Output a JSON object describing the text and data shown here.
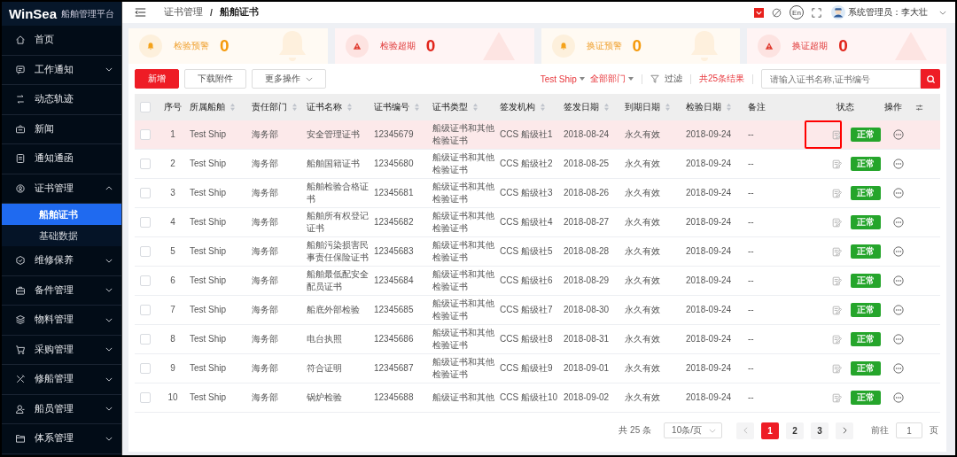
{
  "brand": {
    "logo": "WinSea",
    "subtitle": "船舶管理平台"
  },
  "sidebar": {
    "items": [
      {
        "label": "首页",
        "kind": "link"
      },
      {
        "label": "工作通知",
        "kind": "group",
        "expanded": false
      },
      {
        "label": "动态轨迹",
        "kind": "link"
      },
      {
        "label": "新闻",
        "kind": "link"
      },
      {
        "label": "通知通函",
        "kind": "link"
      },
      {
        "label": "证书管理",
        "kind": "group",
        "expanded": true,
        "children": [
          {
            "label": "船舶证书",
            "selected": true
          },
          {
            "label": "基础数据",
            "selected": false
          }
        ]
      },
      {
        "label": "维修保养",
        "kind": "group",
        "expanded": false
      },
      {
        "label": "备件管理",
        "kind": "group",
        "expanded": false
      },
      {
        "label": "物料管理",
        "kind": "group",
        "expanded": false
      },
      {
        "label": "采购管理",
        "kind": "group",
        "expanded": false
      },
      {
        "label": "修船管理",
        "kind": "group",
        "expanded": false
      },
      {
        "label": "船员管理",
        "kind": "group",
        "expanded": false
      },
      {
        "label": "体系管理",
        "kind": "group",
        "expanded": false
      }
    ]
  },
  "header": {
    "breadcrumb": [
      "证书管理",
      "船舶证书"
    ],
    "separator": "/",
    "lang_button": "En",
    "user": "系统管理员：李大壮"
  },
  "stat_cards": [
    {
      "kind": "warning",
      "label": "检验预警",
      "count": "0"
    },
    {
      "kind": "overdue",
      "label": "检验超期",
      "count": "0"
    },
    {
      "kind": "warning",
      "label": "换证预警",
      "count": "0"
    },
    {
      "kind": "overdue",
      "label": "换证超期",
      "count": "0"
    }
  ],
  "toolbar": {
    "buttons": [
      {
        "label": "新增",
        "kind": "primary"
      },
      {
        "label": "下载附件",
        "kind": "plain"
      },
      {
        "label": "更多操作",
        "kind": "dropdown"
      }
    ],
    "ship_filter": "Test Ship",
    "dept_filter": "全部部门",
    "filter": "过滤",
    "result_count": "共25条结果",
    "search": {
      "placeholder": "请输入证书名称,证书编号"
    }
  },
  "table": {
    "select_all_checked": false,
    "columns": [
      {
        "label": "序号",
        "sortable": false
      },
      {
        "label": "所属船舶",
        "sortable": true
      },
      {
        "label": "责任部门",
        "sortable": true
      },
      {
        "label": "证书名称",
        "sortable": true
      },
      {
        "label": "证书编号",
        "sortable": true
      },
      {
        "label": "证书类型",
        "sortable": true
      },
      {
        "label": "签发机构",
        "sortable": true
      },
      {
        "label": "签发日期",
        "sortable": true
      },
      {
        "label": "到期日期",
        "sortable": true
      },
      {
        "label": "检验日期",
        "sortable": true
      },
      {
        "label": "备注",
        "sortable": false
      },
      {
        "label": "状态",
        "sortable": false
      },
      {
        "label": "操作",
        "sortable": false
      }
    ],
    "rows": [
      {
        "selected": true,
        "checked": false,
        "cells": [
          "1",
          "Test Ship",
          "海务部",
          "安全管理证书",
          "12345679",
          "船级证书和其他检验证书",
          "CCS 船级社1",
          "2018-08-24",
          "永久有效",
          "2018-09-24",
          "--"
        ],
        "status": "正常"
      },
      {
        "selected": false,
        "checked": false,
        "cells": [
          "2",
          "Test Ship",
          "海务部",
          "船舶国籍证书",
          "12345680",
          "船级证书和其他检验证书",
          "CCS 船级社2",
          "2018-08-25",
          "永久有效",
          "2018-09-24",
          "--"
        ],
        "status": "正常"
      },
      {
        "selected": false,
        "checked": false,
        "cells": [
          "3",
          "Test Ship",
          "海务部",
          "船舶检验合格证书",
          "12345681",
          "船级证书和其他检验证书",
          "CCS 船级社3",
          "2018-08-26",
          "永久有效",
          "2018-09-24",
          "--"
        ],
        "status": "正常"
      },
      {
        "selected": false,
        "checked": false,
        "cells": [
          "4",
          "Test Ship",
          "海务部",
          "船舶所有权登记证书",
          "12345682",
          "船级证书和其他检验证书",
          "CCS 船级社4",
          "2018-08-27",
          "永久有效",
          "2018-09-24",
          "--"
        ],
        "status": "正常"
      },
      {
        "selected": false,
        "checked": false,
        "cells": [
          "5",
          "Test Ship",
          "海务部",
          "船舶污染损害民事责任保险证书",
          "12345683",
          "船级证书和其他检验证书",
          "CCS 船级社5",
          "2018-08-28",
          "永久有效",
          "2018-09-24",
          "--"
        ],
        "status": "正常"
      },
      {
        "selected": false,
        "checked": false,
        "cells": [
          "6",
          "Test Ship",
          "海务部",
          "船舶最低配安全配员证书",
          "12345684",
          "船级证书和其他检验证书",
          "CCS 船级社6",
          "2018-08-29",
          "永久有效",
          "2018-09-24",
          "--"
        ],
        "status": "正常"
      },
      {
        "selected": false,
        "checked": false,
        "cells": [
          "7",
          "Test Ship",
          "海务部",
          "船底外部检验",
          "12345685",
          "船级证书和其他检验证书",
          "CCS 船级社7",
          "2018-08-30",
          "永久有效",
          "2018-09-24",
          "--"
        ],
        "status": "正常"
      },
      {
        "selected": false,
        "checked": false,
        "cells": [
          "8",
          "Test Ship",
          "海务部",
          "电台执照",
          "12345686",
          "船级证书和其他检验证书",
          "CCS 船级社8",
          "2018-08-31",
          "永久有效",
          "2018-09-24",
          "--"
        ],
        "status": "正常"
      },
      {
        "selected": false,
        "checked": false,
        "cells": [
          "9",
          "Test Ship",
          "海务部",
          "符合证明",
          "12345687",
          "船级证书和其他检验证书",
          "CCS 船级社9",
          "2018-09-01",
          "永久有效",
          "2018-09-24",
          "--"
        ],
        "status": "正常"
      },
      {
        "selected": false,
        "checked": false,
        "cells": [
          "10",
          "Test Ship",
          "海务部",
          "锅炉检验",
          "12345688",
          "船级证书和其他",
          "CCS 船级社10",
          "2018-09-02",
          "永久有效",
          "2018-09-24",
          "--"
        ],
        "status": "正常"
      }
    ]
  },
  "pagination": {
    "total": "共 25 条",
    "page_size": "10条/页",
    "pages": [
      {
        "label": "1",
        "selected": true
      },
      {
        "label": "2",
        "selected": false
      },
      {
        "label": "3",
        "selected": false
      }
    ],
    "goto_label": "前往",
    "goto_value": "1",
    "goto_suffix": "页"
  }
}
